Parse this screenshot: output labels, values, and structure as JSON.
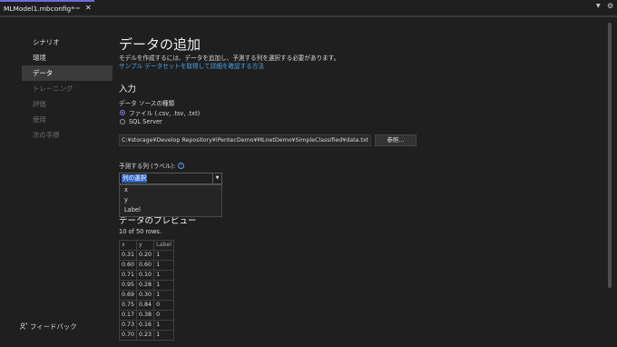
{
  "tab": {
    "title": "MLModel1.mbconfig*",
    "pin_icon": "pin-icon",
    "close_icon": "close-icon"
  },
  "nav": {
    "items": [
      {
        "label": "シナリオ",
        "state": "normal"
      },
      {
        "label": "環境",
        "state": "normal"
      },
      {
        "label": "データ",
        "state": "active"
      },
      {
        "label": "トレーニング",
        "state": "disabled"
      },
      {
        "label": "評価",
        "state": "disabled"
      },
      {
        "label": "使用",
        "state": "disabled"
      },
      {
        "label": "次の手順",
        "state": "disabled"
      }
    ],
    "feedback": "フィードバック"
  },
  "main": {
    "title": "データの追加",
    "description": "モデルを作成するには、データを追加し、予測する列を選択する必要があります。",
    "link": "サンプル データセットを取得して詳細を確認する方法",
    "input_heading": "入力",
    "datasource_label": "データ ソースの種類",
    "radio_file": "ファイル (.csv, .tsv, .txt)",
    "radio_sql": "SQL Server",
    "path": "C:¥storage¥Develop Repository¥iPentecDemo¥MLnetDemo¥SimpleClassified¥data.txt",
    "browse": "参照...",
    "predict_label": "予測する列 (ラベル):",
    "combo_value": "列の選択",
    "dropdown_options": [
      "x",
      "y",
      "Label"
    ],
    "preview_title": "データのプレビュー",
    "rows_count": "10 of 50 rows."
  },
  "preview": {
    "headers": [
      "x",
      "y",
      "Label"
    ],
    "rows": [
      [
        "0.31",
        "0.20",
        "1"
      ],
      [
        "0.60",
        "0.60",
        "1"
      ],
      [
        "0.71",
        "0.10",
        "1"
      ],
      [
        "0.95",
        "0.28",
        "1"
      ],
      [
        "0.69",
        "0.30",
        "1"
      ],
      [
        "0.75",
        "0.84",
        "0"
      ],
      [
        "0.17",
        "0.38",
        "0"
      ],
      [
        "0.73",
        "0.16",
        "1"
      ],
      [
        "0.70",
        "0.23",
        "1"
      ]
    ]
  },
  "colors": {
    "accent": "#6d6ddb",
    "link": "#4aa3e8",
    "selection": "#2b63c7"
  }
}
